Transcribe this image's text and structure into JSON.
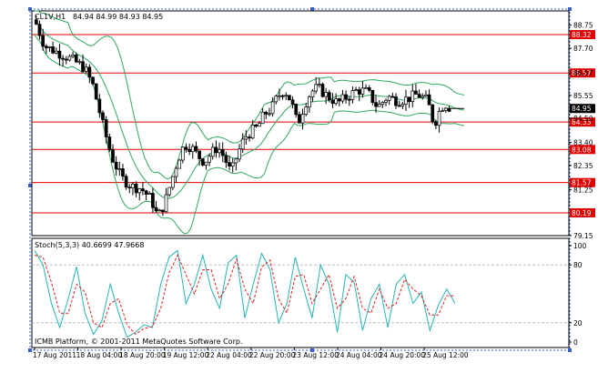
{
  "chart_data": [
    {
      "type": "candlestick",
      "title": "CL1V,H1",
      "ohlc_header": "84.94 84.99 84.93 84.95",
      "ylim": [
        79.15,
        89.4
      ],
      "price_ticks": [
        88.75,
        87.7,
        86.57,
        85.55,
        84.5,
        83.4,
        82.35,
        81.25,
        79.15
      ],
      "current_price_label": "84.95",
      "levels": [
        {
          "value": 88.32,
          "label": "88.32"
        },
        {
          "value": 86.57,
          "label": "86.57"
        },
        {
          "value": 84.33,
          "label": "84.33"
        },
        {
          "value": 83.08,
          "label": "83.08"
        },
        {
          "value": 81.57,
          "label": "81.57"
        },
        {
          "value": 80.19,
          "label": "80.19"
        }
      ],
      "series_path": [
        [
          0,
          89.0
        ],
        [
          6,
          87.8
        ],
        [
          14,
          87.5
        ],
        [
          22,
          87.2
        ],
        [
          30,
          86.8
        ],
        [
          35,
          86.0
        ],
        [
          40,
          84.5
        ],
        [
          46,
          82.8
        ],
        [
          52,
          81.8
        ],
        [
          58,
          81.4
        ],
        [
          64,
          81.3
        ],
        [
          70,
          80.8
        ],
        [
          74,
          80.0
        ],
        [
          78,
          80.6
        ],
        [
          82,
          81.6
        ],
        [
          86,
          82.6
        ],
        [
          90,
          83.3
        ],
        [
          94,
          83.2
        ],
        [
          98,
          82.8
        ],
        [
          102,
          82.5
        ],
        [
          106,
          82.9
        ],
        [
          110,
          83.2
        ],
        [
          114,
          82.7
        ],
        [
          118,
          82.0
        ],
        [
          122,
          82.9
        ],
        [
          126,
          83.6
        ],
        [
          130,
          83.9
        ],
        [
          134,
          84.1
        ],
        [
          138,
          84.7
        ],
        [
          142,
          84.9
        ],
        [
          146,
          85.5
        ],
        [
          150,
          85.8
        ],
        [
          154,
          85.3
        ],
        [
          158,
          84.2
        ],
        [
          162,
          85.1
        ],
        [
          166,
          85.7
        ],
        [
          170,
          85.9
        ],
        [
          176,
          85.5
        ],
        [
          182,
          85.2
        ],
        [
          188,
          85.5
        ],
        [
          194,
          85.8
        ],
        [
          200,
          85.7
        ],
        [
          206,
          85.0
        ],
        [
          212,
          85.5
        ],
        [
          218,
          85.3
        ],
        [
          224,
          85.4
        ],
        [
          230,
          85.6
        ],
        [
          236,
          85.3
        ],
        [
          240,
          84.2
        ],
        [
          243,
          84.8
        ],
        [
          246,
          85.2
        ],
        [
          250,
          84.95
        ],
        [
          258,
          84.95
        ]
      ],
      "x_ticks": [
        {
          "label": "17 Aug 2011",
          "pos": 0
        },
        {
          "label": "18 Aug 04:00",
          "pos": 26
        },
        {
          "label": "18 Aug 20:00",
          "pos": 52
        },
        {
          "label": "19 Aug 12:00",
          "pos": 78
        },
        {
          "label": "22 Aug 04:00",
          "pos": 104
        },
        {
          "label": "22 Aug 20:00",
          "pos": 130
        },
        {
          "label": "23 Aug 12:00",
          "pos": 156
        },
        {
          "label": "24 Aug 04:00",
          "pos": 182
        },
        {
          "label": "24 Aug 20:00",
          "pos": 208
        },
        {
          "label": "25 Aug 12:00",
          "pos": 234
        }
      ]
    },
    {
      "type": "line",
      "title": "Stoch(5,3,3) 40.6699 47.9668",
      "ylim": [
        0,
        100
      ],
      "y_ticks": [
        100,
        80,
        20,
        0
      ],
      "series": [
        {
          "color": "#28b4b4",
          "values": [
            95,
            80,
            40,
            15,
            45,
            78,
            30,
            8,
            22,
            60,
            30,
            5,
            10,
            18,
            15,
            60,
            88,
            95,
            40,
            60,
            90,
            55,
            35,
            82,
            90,
            25,
            60,
            92,
            75,
            20,
            40,
            88,
            55,
            25,
            80,
            60,
            10,
            70,
            62,
            12,
            45,
            60,
            15,
            60,
            70,
            40,
            52,
            12,
            38,
            55,
            40
          ]
        },
        {
          "color": "#e02020",
          "values": [
            90,
            88,
            62,
            30,
            30,
            60,
            52,
            20,
            15,
            40,
            45,
            18,
            8,
            14,
            16,
            35,
            72,
            90,
            70,
            50,
            75,
            75,
            45,
            60,
            86,
            55,
            40,
            78,
            85,
            45,
            30,
            68,
            70,
            40,
            55,
            70,
            35,
            45,
            68,
            35,
            30,
            55,
            35,
            40,
            65,
            55,
            48,
            28,
            28,
            48,
            48
          ]
        }
      ],
      "footer": "ICMB Platform, © 2001-2011 MetaQuotes Software Corp."
    }
  ]
}
